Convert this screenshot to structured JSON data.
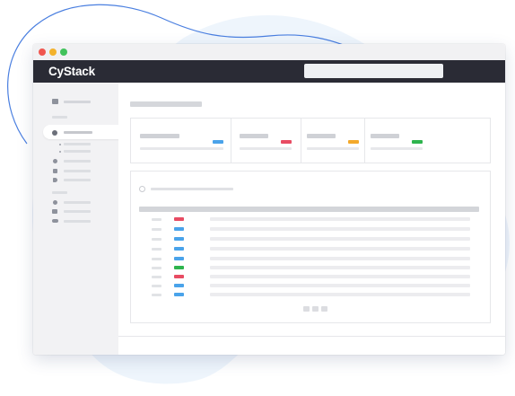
{
  "app": {
    "brand": "CyStack"
  },
  "colors": {
    "appbar": "#2a2b35",
    "badge_blue": "#4aa3ea",
    "badge_red": "#e84c63",
    "badge_orange": "#f3a92b",
    "badge_green": "#2eb44e",
    "blob": "#eef5fc",
    "blob_stroke": "#4a7fe0"
  },
  "window_controls": [
    "close",
    "minimize",
    "maximize"
  ],
  "stat_badges": [
    "blue",
    "red",
    "orange",
    "green"
  ],
  "table_tags": [
    "red",
    "blue",
    "blue",
    "blue",
    "blue",
    "green",
    "red",
    "blue",
    "blue"
  ],
  "sidebar_icons": [
    "dashboard-icon",
    "search-icon",
    "bug-icon",
    "chart-icon",
    "tag-icon",
    "gear-icon",
    "inbox-icon",
    "toggle-icon"
  ]
}
